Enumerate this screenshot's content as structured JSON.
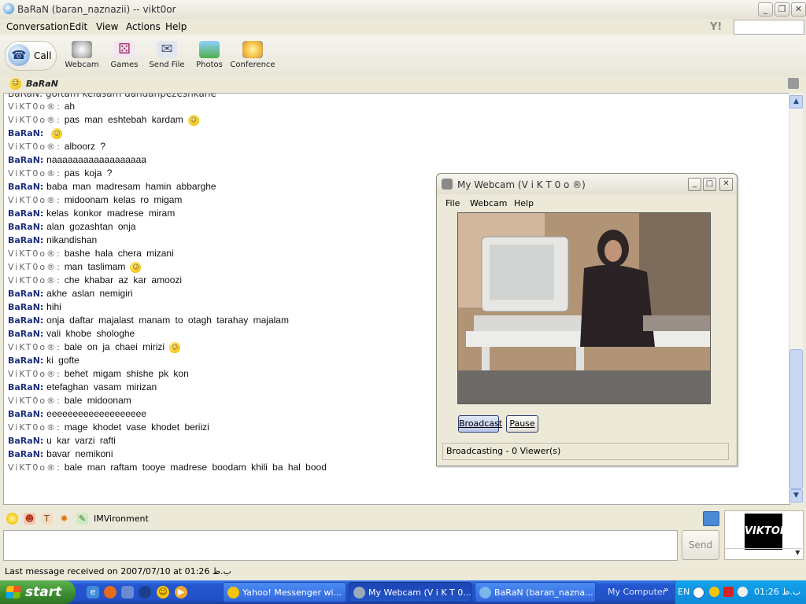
{
  "window": {
    "title": "BaRaN (baran_naznazii) -- vikt0or",
    "minimize": "_",
    "maximize": "❐",
    "close": "✕"
  },
  "menu": [
    "Conversation",
    "Edit",
    "View",
    "Actions",
    "Help"
  ],
  "search": {
    "logo": "Y!",
    "placeholder": ""
  },
  "toolbar": {
    "call": "Call",
    "webcam": "Webcam",
    "games": "Games",
    "send_file": "Send File",
    "photos": "Photos",
    "conference": "Conference"
  },
  "contact": {
    "name": "BaRaN"
  },
  "conversation": {
    "partial_line": "BaRaN: goftam kelasam dandanpezeshkane",
    "messages": [
      {
        "nick": "ViKT0o®:",
        "text": "ah",
        "emoticon": false
      },
      {
        "nick": "ViKT0o®:",
        "text": "pas man eshtebah kardam",
        "emoticon": true
      },
      {
        "nick": "BaRaN:",
        "text": "",
        "emoticon": true
      },
      {
        "nick": "ViKT0o®:",
        "text": "alboorz ?",
        "emoticon": false
      },
      {
        "nick": "BaRaN:",
        "text": "naaaaaaaaaaaaaaaaaa",
        "emoticon": false
      },
      {
        "nick": "ViKT0o®:",
        "text": "pas koja ?",
        "emoticon": false
      },
      {
        "nick": "BaRaN:",
        "text": "baba man madresam hamin abbarghe",
        "emoticon": false
      },
      {
        "nick": "ViKT0o®:",
        "text": "midoonam kelas ro migam",
        "emoticon": false
      },
      {
        "nick": "BaRaN:",
        "text": "kelas konkor madrese miram",
        "emoticon": false
      },
      {
        "nick": "BaRaN:",
        "text": "alan gozashtan onja",
        "emoticon": false
      },
      {
        "nick": "BaRaN:",
        "text": "nikandishan",
        "emoticon": false
      },
      {
        "nick": "ViKT0o®:",
        "text": "bashe hala chera mizani",
        "emoticon": false
      },
      {
        "nick": "ViKT0o®:",
        "text": "man taslimam",
        "emoticon": true
      },
      {
        "nick": "ViKT0o®:",
        "text": "che khabar az kar amoozi",
        "emoticon": false
      },
      {
        "nick": "BaRaN:",
        "text": "akhe aslan nemigiri",
        "emoticon": false
      },
      {
        "nick": "BaRaN:",
        "text": "hihi",
        "emoticon": false
      },
      {
        "nick": "BaRaN:",
        "text": "onja daftar majalast manam to otagh tarahay majalam",
        "emoticon": false
      },
      {
        "nick": "BaRaN:",
        "text": "vali khobe shologhe",
        "emoticon": false
      },
      {
        "nick": "ViKT0o®:",
        "text": "bale on ja chaei mirizi",
        "emoticon": true
      },
      {
        "nick": "BaRaN:",
        "text": "ki gofte",
        "emoticon": false
      },
      {
        "nick": "ViKT0o®:",
        "text": "behet migam shishe pk kon",
        "emoticon": false
      },
      {
        "nick": "BaRaN:",
        "text": "etefaghan vasam mirizan",
        "emoticon": false
      },
      {
        "nick": "ViKT0o®:",
        "text": "bale midoonam",
        "emoticon": false
      },
      {
        "nick": "BaRaN:",
        "text": "eeeeeeeeeeeeeeeeeee",
        "emoticon": false
      },
      {
        "nick": "ViKT0o®:",
        "text": "mage khodet vase khodet beriizi",
        "emoticon": false
      },
      {
        "nick": "BaRaN:",
        "text": "u kar varzi rafti",
        "emoticon": false
      },
      {
        "nick": "BaRaN:",
        "text": "bavar nemikoni",
        "emoticon": false
      },
      {
        "nick": "ViKT0o®:",
        "text": "bale man raftam tooye madrese boodam khili ba hal bood",
        "emoticon": false
      }
    ]
  },
  "webcam": {
    "title": "My Webcam (V i K T 0 o ®)",
    "menu": [
      "File",
      "Webcam",
      "Help"
    ],
    "broadcast": "Broadcast",
    "pause": "Pause",
    "status": "Broadcasting - 0 Viewer(s)"
  },
  "emotebar": {
    "imvironment": "IMVironment"
  },
  "compose": {
    "send": "Send",
    "value": ""
  },
  "avatar": {
    "logo_text": "VIKTOR"
  },
  "status": {
    "text": "Last message received on 2007/07/10 at 01:26 ب.ظ"
  },
  "taskbar": {
    "start": "start",
    "tasks": [
      "Yahoo! Messenger wi...",
      "My Webcam (V i K T 0...",
      "BaRaN (baran_nazna..."
    ],
    "my_computer": "My Computer",
    "lang": "EN",
    "clock": "01:26 ب.ظ"
  },
  "colors": {
    "baran_nick": "#1e2f7a",
    "viktor_nick": "#666666",
    "taskbar": "#2556cf",
    "start": "#3a8b2f"
  }
}
